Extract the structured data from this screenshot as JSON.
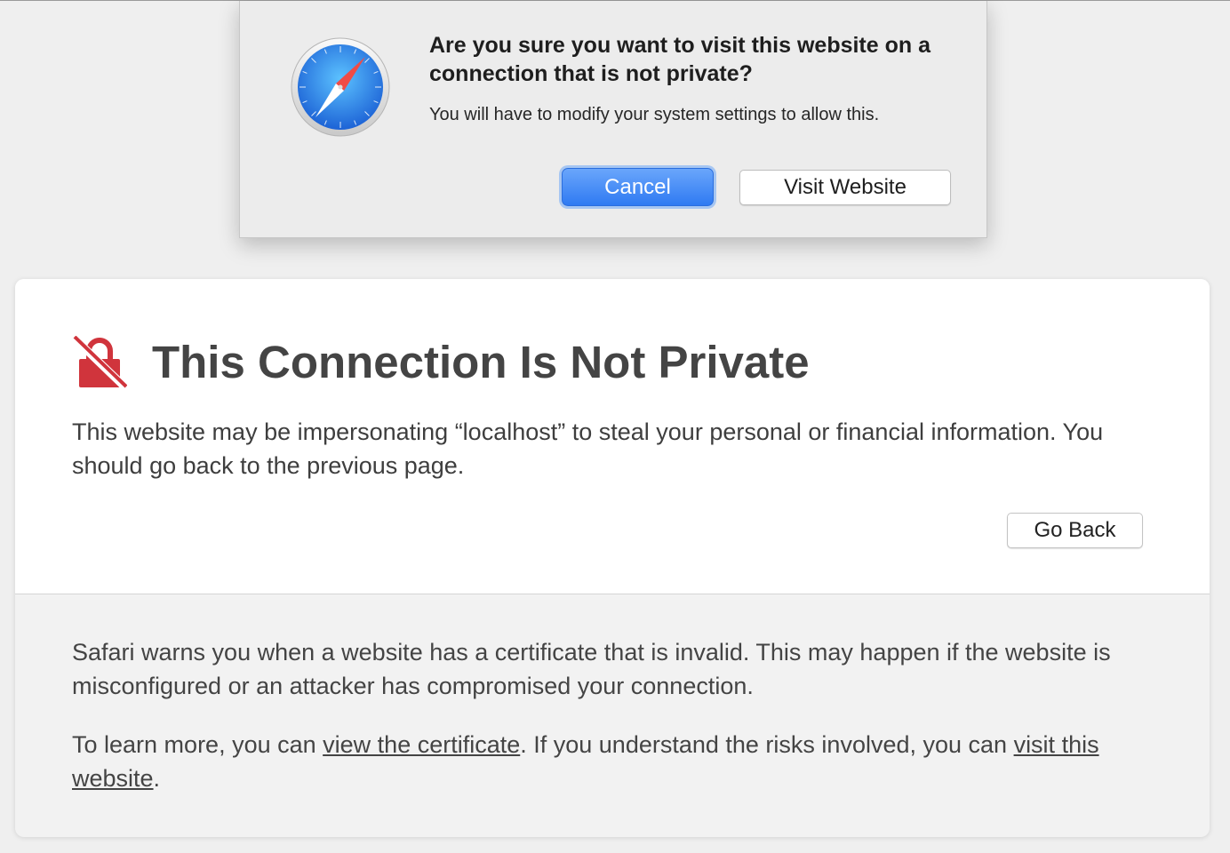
{
  "alert": {
    "title": "Are you sure you want to visit this website on a connection that is not private?",
    "message": "You will have to modify your system settings to allow this.",
    "cancel_label": "Cancel",
    "visit_label": "Visit Website",
    "icon": "safari-compass-icon",
    "accent_color": "#2f7af2"
  },
  "warning": {
    "icon": "lock-slash-icon",
    "icon_color": "#d0343c",
    "title": "This Connection Is Not Private",
    "description": "This website may be impersonating “localhost” to steal your personal or financial information. You should go back to the previous page.",
    "go_back_label": "Go Back",
    "info_text": "Safari warns you when a website has a certificate that is invalid. This may happen if the website is misconfigured or an attacker has compromised your connection.",
    "learn_more_prefix": "To learn more, you can ",
    "view_certificate_link": "view the certificate",
    "learn_more_middle": ". If you understand the risks involved, you can ",
    "visit_link": "visit this website",
    "learn_more_suffix": "."
  }
}
